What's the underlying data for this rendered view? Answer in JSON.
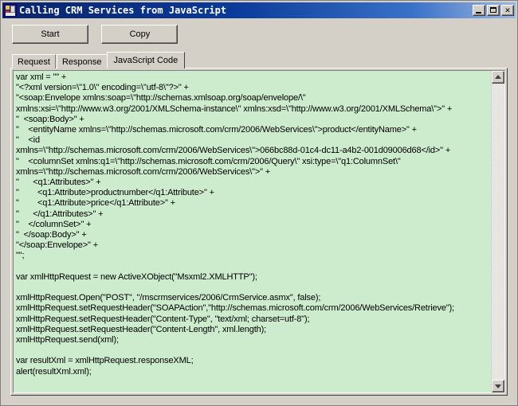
{
  "window": {
    "title": "Calling CRM Services from JavaScript",
    "icon": "app-icon",
    "caption_buttons": [
      {
        "name": "minimize",
        "label": "_"
      },
      {
        "name": "maximize",
        "label": "□"
      },
      {
        "name": "close",
        "label": "✕"
      }
    ]
  },
  "toolbar": {
    "start_label": "Start",
    "copy_label": "Copy"
  },
  "tabs": [
    {
      "label": "Request",
      "selected": false
    },
    {
      "label": "Response",
      "selected": false
    },
    {
      "label": "JavaScript Code",
      "selected": true
    }
  ],
  "code": {
    "language": "javascript",
    "lines": [
      "var xml = \"\" +",
      "\"<?xml version=\\\"1.0\\\" encoding=\\\"utf-8\\\"?>\" +",
      "\"<soap:Envelope xmlns:soap=\\\"http://schemas.xmlsoap.org/soap/envelope/\\\"",
      "xmlns:xsi=\\\"http://www.w3.org/2001/XMLSchema-instance\\\" xmlns:xsd=\\\"http://www.w3.org/2001/XMLSchema\\\">\" +",
      "\"  <soap:Body>\" +",
      "\"    <entityName xmlns=\\\"http://schemas.microsoft.com/crm/2006/WebServices\\\">product</entityName>\" +",
      "\"    <id",
      "xmlns=\\\"http://schemas.microsoft.com/crm/2006/WebServices\\\">066bc88d-01c4-dc11-a4b2-001d09006d68</id>\" +",
      "\"    <columnSet xmlns:q1=\\\"http://schemas.microsoft.com/crm/2006/Query\\\" xsi:type=\\\"q1:ColumnSet\\\"",
      "xmlns=\\\"http://schemas.microsoft.com/crm/2006/WebServices\\\">\" +",
      "\"      <q1:Attributes>\" +",
      "\"        <q1:Attribute>productnumber</q1:Attribute>\" +",
      "\"        <q1:Attribute>price</q1:Attribute>\" +",
      "\"      </q1:Attributes>\" +",
      "\"    </columnSet>\" +",
      "\"  </soap:Body>\" +",
      "\"</soap:Envelope>\" +",
      "\"\";",
      "",
      "var xmlHttpRequest = new ActiveXObject(\"Msxml2.XMLHTTP\");",
      "",
      "xmlHttpRequest.Open(\"POST\", \"/mscrmservices/2006/CrmService.asmx\", false);",
      "xmlHttpRequest.setRequestHeader(\"SOAPAction\",\"http://schemas.microsoft.com/crm/2006/WebServices/Retrieve\");",
      "xmlHttpRequest.setRequestHeader(\"Content-Type\", \"text/xml; charset=utf-8\");",
      "xmlHttpRequest.setRequestHeader(\"Content-Length\", xml.length);",
      "xmlHttpRequest.send(xml);",
      "",
      "var resultXml = xmlHttpRequest.responseXML;",
      "alert(resultXml.xml);"
    ]
  },
  "scrollbar": {
    "up_arrow": "scroll-up-arrow",
    "down_arrow": "scroll-down-arrow"
  },
  "colors": {
    "window_face": "#d4d0c8",
    "title_active_start": "#0a246a",
    "title_active_end": "#9cb6de",
    "code_background": "#cdebcd",
    "text": "#000000"
  }
}
